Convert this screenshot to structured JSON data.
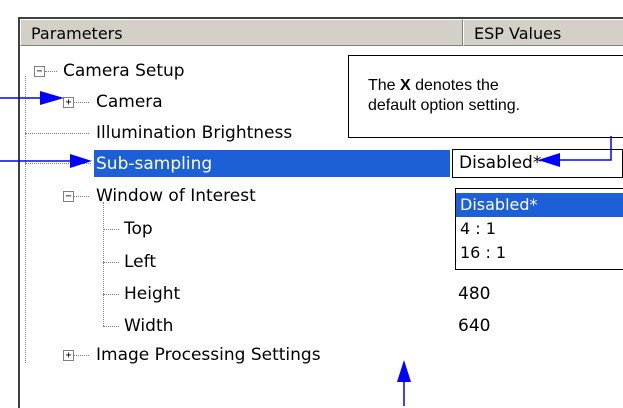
{
  "header": {
    "col_params": "Parameters",
    "col_values": "ESP Values"
  },
  "tree": {
    "camera_setup": "Camera Setup",
    "camera": "Camera",
    "illumination": "Illumination Brightness",
    "subsampling": "Sub-sampling",
    "window": "Window of Interest",
    "top": "Top",
    "left": "Left",
    "height": "Height",
    "width": "Width",
    "image_processing": "Image Processing Settings"
  },
  "values": {
    "subsampling": "Disabled*",
    "height": "480",
    "width": "640"
  },
  "dropdown": {
    "options": [
      "Disabled*",
      "4 : 1",
      "16 : 1"
    ],
    "selected": "Disabled*"
  },
  "callout": {
    "line1_pre": "The ",
    "line1_bold": "X",
    "line1_post": " denotes the",
    "line2": "default option setting."
  },
  "colors": {
    "selection": "#1c5fd6",
    "arrow": "#0000ff"
  },
  "glyphs": {
    "minus": "−",
    "plus": "+"
  }
}
